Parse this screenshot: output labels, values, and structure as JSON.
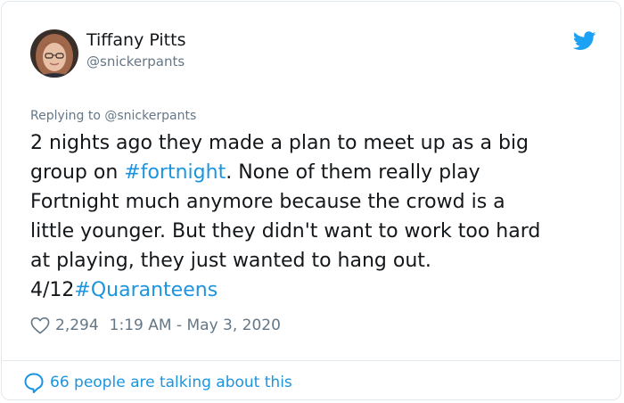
{
  "author": {
    "name": "Tiffany Pitts",
    "handle": "@snickerpants"
  },
  "tweet": {
    "replying_to": "Replying to @snickerpants",
    "text_lines": [
      [
        "2 nights ago they made a plan to meet up as a big"
      ],
      [
        "group on ",
        "#fortnight",
        ". None of them really play"
      ],
      [
        "Fortnight much anymore because the crowd is a"
      ],
      [
        "little younger. But they didn't want to work too hard"
      ],
      [
        "at playing, they just wanted to hang out."
      ],
      [
        "4/12",
        "#Quaranteens"
      ]
    ],
    "likes": "2,294",
    "timestamp": "1:19 AM - May 3, 2020"
  },
  "footer": {
    "conversation": "66 people are talking about this"
  },
  "icons": {
    "brand": "twitter-bird-icon",
    "like": "heart-icon",
    "conversation": "speech-bubble-icon"
  },
  "colors": {
    "link": "#1b95e0",
    "text": "#14171a",
    "secondary": "#657786",
    "border": "#e1e8ed"
  }
}
